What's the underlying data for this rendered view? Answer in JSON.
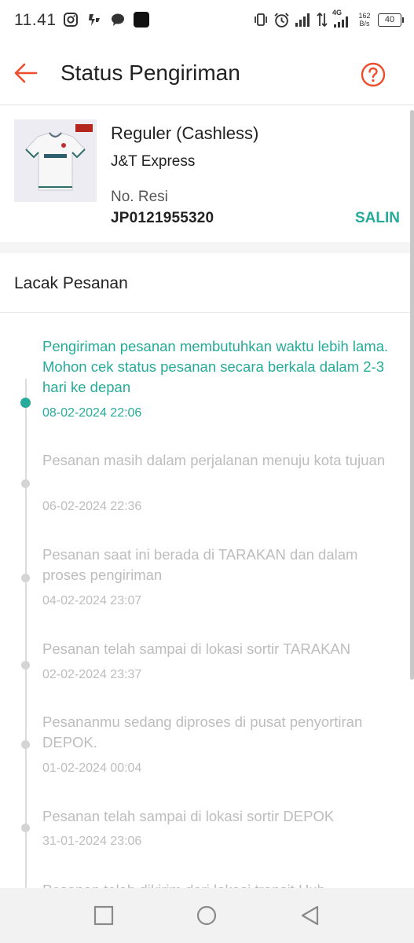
{
  "status_bar": {
    "time": "11.41",
    "network": "4G",
    "speed_value": "162",
    "speed_unit": "B/s",
    "battery": "40"
  },
  "header": {
    "title": "Status Pengiriman",
    "back_icon": "arrow-left-icon",
    "help_icon": "question-circle-icon"
  },
  "shipping": {
    "method": "Reguler (Cashless)",
    "courier": "J&T Express",
    "resi_label": "No. Resi",
    "resi_number": "JP0121955320",
    "copy_label": "SALIN"
  },
  "tracking": {
    "title": "Lacak Pesanan",
    "events": [
      {
        "desc": "Pengiriman pesanan membutuhkan waktu lebih lama. Mohon cek status pesanan secara berkala dalam 2-3 hari ke depan",
        "time": "08-02-2024 22:06",
        "active": true
      },
      {
        "desc": "Pesanan masih dalam perjalanan menuju kota tujuan",
        "time": "06-02-2024 22:36",
        "active": false
      },
      {
        "desc": "Pesanan saat ini berada di TARAKAN dan dalam proses pengiriman",
        "time": "04-02-2024 23:07",
        "active": false
      },
      {
        "desc": "Pesanan telah sampai di lokasi sortir TARAKAN",
        "time": "02-02-2024 23:37",
        "active": false
      },
      {
        "desc": "Pesananmu sedang diproses di pusat penyortiran DEPOK.",
        "time": "01-02-2024 00:04",
        "active": false
      },
      {
        "desc": "Pesanan telah sampai di lokasi sortir DEPOK",
        "time": "31-01-2024 23:06",
        "active": false
      },
      {
        "desc": "Pesanan telah dikirim dari lokasi transit Hub",
        "time": "",
        "active": false
      }
    ]
  },
  "colors": {
    "accent": "#26aa99",
    "brand": "#ee4d2d",
    "muted": "#bdbdbd"
  },
  "nav": {
    "recents_icon": "square-icon",
    "home_icon": "circle-icon",
    "back_icon": "triangle-back-icon"
  }
}
